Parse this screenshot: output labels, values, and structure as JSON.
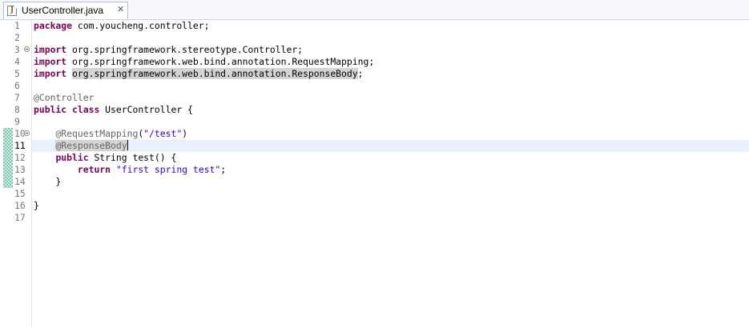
{
  "tab": {
    "title": "UserController.java",
    "icon": "java-file-icon",
    "close_icon": "close-icon",
    "close_glyph": "✕",
    "icon_letter": "J"
  },
  "editor": {
    "colors": {
      "keyword": "#7f0055",
      "annotation": "#646464",
      "string": "#2a00ff",
      "current_line": "#e8f2fe",
      "occurrence": "#d4d4d4"
    },
    "lines": [
      {
        "n": "1",
        "tokens": [
          {
            "t": "package",
            "c": "kw"
          },
          {
            "t": " com.youcheng.controller;"
          }
        ]
      },
      {
        "n": "2",
        "tokens": []
      },
      {
        "n": "3",
        "fold": true,
        "tokens": [
          {
            "t": "import",
            "c": "kw"
          },
          {
            "t": " org.springframework.stereotype.Controller;"
          }
        ]
      },
      {
        "n": "4",
        "tokens": [
          {
            "t": "import",
            "c": "kw"
          },
          {
            "t": " org.springframework.web.bind.annotation.RequestMapping;"
          }
        ]
      },
      {
        "n": "5",
        "tokens": [
          {
            "t": "import",
            "c": "kw"
          },
          {
            "t": " "
          },
          {
            "t": "org.springframework.web.bind.annotation.ResponseBody",
            "c": "hl"
          },
          {
            "t": ";"
          }
        ]
      },
      {
        "n": "6",
        "tokens": []
      },
      {
        "n": "7",
        "tokens": [
          {
            "t": "@Controller",
            "c": "an"
          }
        ]
      },
      {
        "n": "8",
        "tokens": [
          {
            "t": "public",
            "c": "kw"
          },
          {
            "t": " "
          },
          {
            "t": "class",
            "c": "kw"
          },
          {
            "t": " UserController {"
          }
        ]
      },
      {
        "n": "9",
        "tokens": []
      },
      {
        "n": "10",
        "fold": true,
        "tokens": [
          {
            "t": "    "
          },
          {
            "t": "@RequestMapping",
            "c": "an"
          },
          {
            "t": "("
          },
          {
            "t": "\"/test\"",
            "c": "str"
          },
          {
            "t": ")"
          }
        ]
      },
      {
        "n": "11",
        "active": true,
        "tokens": [
          {
            "t": "    "
          },
          {
            "t": "@ResponseBody",
            "c": "an hl"
          },
          {
            "caret": true
          }
        ]
      },
      {
        "n": "12",
        "tokens": [
          {
            "t": "    "
          },
          {
            "t": "public",
            "c": "kw"
          },
          {
            "t": " String test() {"
          }
        ]
      },
      {
        "n": "13",
        "tokens": [
          {
            "t": "        "
          },
          {
            "t": "return",
            "c": "kw"
          },
          {
            "t": " "
          },
          {
            "t": "\"first spring test\"",
            "c": "str"
          },
          {
            "t": ";"
          }
        ]
      },
      {
        "n": "14",
        "tokens": [
          {
            "t": "    }"
          }
        ]
      },
      {
        "n": "15",
        "tokens": []
      },
      {
        "n": "16",
        "tokens": [
          {
            "t": "}"
          }
        ]
      },
      {
        "n": "17",
        "tokens": []
      }
    ]
  }
}
